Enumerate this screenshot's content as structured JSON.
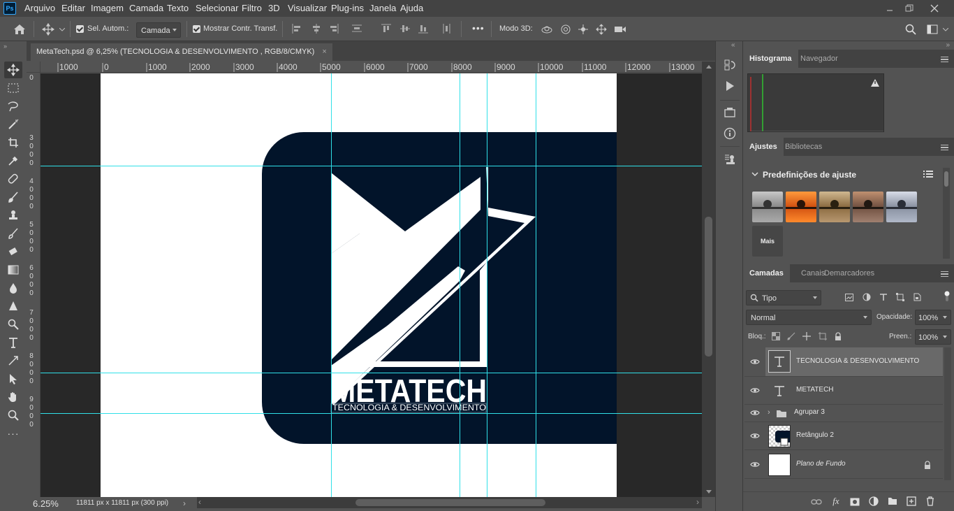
{
  "app": {
    "name": "Ps"
  },
  "menu": [
    "Arquivo",
    "Editar",
    "Imagem",
    "Camada",
    "Texto",
    "Selecionar",
    "Filtro",
    "3D",
    "Visualizar",
    "Plug-ins",
    "Janela",
    "Ajuda"
  ],
  "options": {
    "auto_select_label": "Sel. Autom.:",
    "auto_select_value": "Camada",
    "show_transform_label": "Mostrar Contr. Transf.",
    "more_label": "•••",
    "mode3d_label": "Modo 3D:"
  },
  "document": {
    "tab_title": "MetaTech.psd @ 6,25% (TECNOLOGIA & DESENVOLVIMENTO  , RGB/8/CMYK)",
    "close_glyph": "×",
    "zoom": "6.25%",
    "dimensions": "11811 px x 11811 px (300 ppi)",
    "ruler_top": [
      "1000",
      "0",
      "1000",
      "2000",
      "3000",
      "4000",
      "5000",
      "6000",
      "7000",
      "8000",
      "9000",
      "10000",
      "11000",
      "12000",
      "13000"
    ],
    "ruler_left": [
      "0",
      "3000",
      "4000",
      "5000",
      "6000",
      "7000",
      "8000",
      "9000"
    ],
    "logo_text": "METATECH",
    "logo_subtext": "TECNOLOGIA & DESENVOLVIMENTO"
  },
  "panels": {
    "top_tabs": [
      "Histograma",
      "Navegador"
    ],
    "mid_tabs": [
      "Ajustes",
      "Bibliotecas"
    ],
    "adjust_title": "Predefinições de ajuste",
    "more_label": "Mais",
    "layer_tabs": [
      "Camadas",
      "Canais",
      "Demarcadores"
    ],
    "filter_kind": "Tipo",
    "blend_mode": "Normal",
    "opacity_label": "Opacidade:",
    "opacity_value": "100%",
    "lock_label": "Bloq.:",
    "fill_label": "Preen.:",
    "fill_value": "100%",
    "layers": [
      {
        "name": "TECNOLOGIA & DESENVOLVIMENTO",
        "kind": "text",
        "selected": true
      },
      {
        "name": "METATECH",
        "kind": "text",
        "selected": false
      },
      {
        "name": "Agrupar 3",
        "kind": "group",
        "selected": false
      },
      {
        "name": "Retângulo 2",
        "kind": "shape",
        "selected": false
      },
      {
        "name": "Plano de Fundo",
        "kind": "background",
        "selected": false
      }
    ]
  },
  "colors": {
    "logo_bg": "#02142a",
    "guide": "#30e0e8",
    "ps_blue": "#31a8ff"
  }
}
